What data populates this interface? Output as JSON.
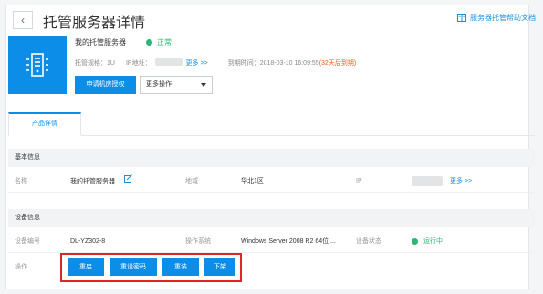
{
  "header": {
    "back_icon": "chevron-left-icon",
    "title": "托管服务器详情",
    "help_link": "服务器托管帮助文档",
    "help_icon": "book-icon"
  },
  "server": {
    "name": "我的托管服务器",
    "status": "正常",
    "spec_label": "托管规格：1U",
    "ip_label": "IP地址：",
    "more_link": "更多 >>",
    "expire_label": "到期时间：2018-03-10 16:09:55",
    "expire_warning": "(32天后到期)",
    "apply_button": "申请机房授权",
    "more_ops_select": "更多操作"
  },
  "tabs": [
    {
      "label": "产品详情"
    }
  ],
  "basic_info": {
    "section_title": "基本信息",
    "name_label": "名称",
    "name_value": "我的托管服务器",
    "region_label": "地域",
    "region_value": "华北1区",
    "ip_label": "IP",
    "more_link": "更多 >>"
  },
  "device_info": {
    "section_title": "设备信息",
    "id_label": "设备编号",
    "id_value": "DL-YZ302-8",
    "os_label": "操作系统",
    "os_value": "Windows Server 2008 R2 64位 ...",
    "status_label": "设备状态",
    "status_value": "运行中",
    "ops_label": "操作",
    "ops_buttons": [
      "重启",
      "重设密码",
      "重装",
      "下架"
    ]
  },
  "colors": {
    "accent": "#0c8ee8",
    "ok": "#2bb673",
    "warn": "#f05a23",
    "highlight": "#e0242c"
  }
}
